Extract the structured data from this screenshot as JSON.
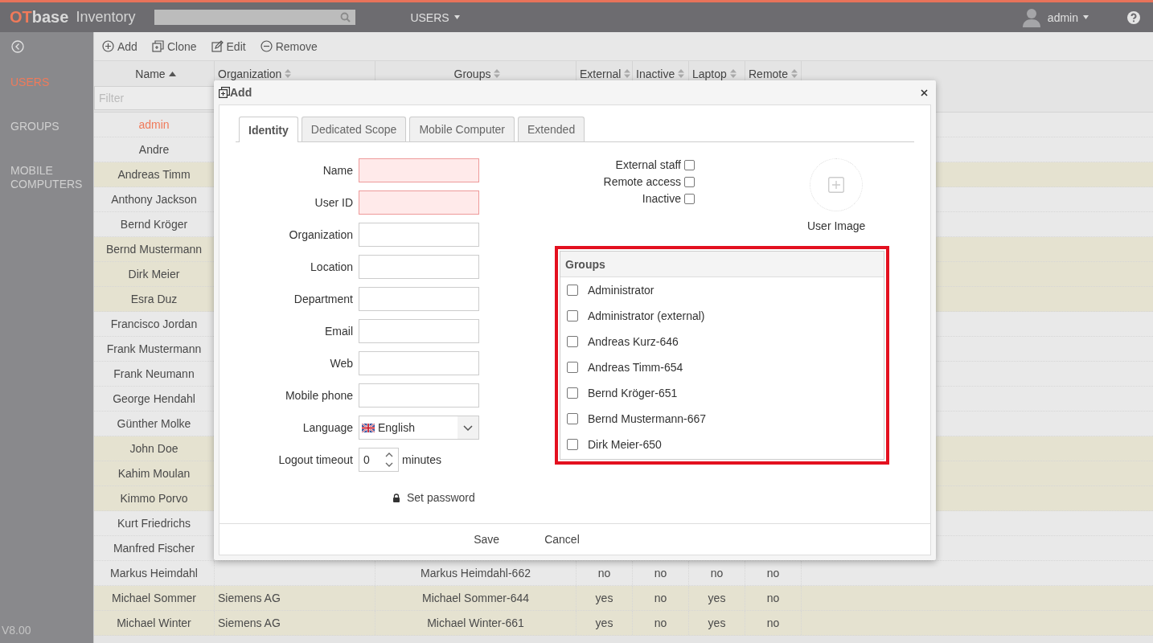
{
  "topbar": {
    "logo_accent": "OT",
    "logo_rest": "base",
    "title": "Inventory",
    "nav": "USERS",
    "user": "admin"
  },
  "sidebar": {
    "items": [
      {
        "label": "USERS",
        "selected": true
      },
      {
        "label": "GROUPS",
        "selected": false
      },
      {
        "label": "MOBILE COMPUTERS",
        "selected": false
      }
    ],
    "version": "V8.00"
  },
  "toolbar": [
    {
      "label": "Add",
      "kind": "add"
    },
    {
      "label": "Clone",
      "kind": "clone"
    },
    {
      "label": "Edit",
      "kind": "edit"
    },
    {
      "label": "Remove",
      "kind": "remove"
    }
  ],
  "table": {
    "columns": [
      {
        "label": "Name",
        "sorted": true
      },
      {
        "label": "Organization",
        "sorted": false
      },
      {
        "label": "Groups",
        "sorted": false
      },
      {
        "label": "External",
        "sorted": false
      },
      {
        "label": "Inactive",
        "sorted": false
      },
      {
        "label": "Laptop",
        "sorted": false
      },
      {
        "label": "Remote",
        "sorted": false
      }
    ],
    "filter_placeholder": "Filter",
    "rows": [
      {
        "cells": [
          "admin"
        ],
        "selected": true,
        "highlighted": false
      },
      {
        "cells": [
          "Andre"
        ],
        "selected": false,
        "highlighted": false
      },
      {
        "cells": [
          "Andreas Timm"
        ],
        "selected": false,
        "highlighted": true
      },
      {
        "cells": [
          "Anthony Jackson"
        ],
        "selected": false,
        "highlighted": false
      },
      {
        "cells": [
          "Bernd Kröger"
        ],
        "selected": false,
        "highlighted": false
      },
      {
        "cells": [
          "Bernd Mustermann"
        ],
        "selected": false,
        "highlighted": true
      },
      {
        "cells": [
          "Dirk Meier"
        ],
        "selected": false,
        "highlighted": true
      },
      {
        "cells": [
          "Esra Duz"
        ],
        "selected": false,
        "highlighted": true
      },
      {
        "cells": [
          "Francisco Jordan"
        ],
        "selected": false,
        "highlighted": false
      },
      {
        "cells": [
          "Frank Mustermann"
        ],
        "selected": false,
        "highlighted": false
      },
      {
        "cells": [
          "Frank Neumann"
        ],
        "selected": false,
        "highlighted": false
      },
      {
        "cells": [
          "George Hendahl"
        ],
        "selected": false,
        "highlighted": false
      },
      {
        "cells": [
          "Günther Molke"
        ],
        "selected": false,
        "highlighted": false
      },
      {
        "cells": [
          "John Doe"
        ],
        "selected": false,
        "highlighted": true
      },
      {
        "cells": [
          "Kahim Moulan"
        ],
        "selected": false,
        "highlighted": true
      },
      {
        "cells": [
          "Kimmo Porvo"
        ],
        "selected": false,
        "highlighted": true
      },
      {
        "cells": [
          "Kurt Friedrichs"
        ],
        "selected": false,
        "highlighted": false
      },
      {
        "cells": [
          "Manfred Fischer"
        ],
        "selected": false,
        "highlighted": false
      },
      {
        "cells": [
          "Markus Heimdahl",
          "",
          "Markus Heimdahl-662",
          "no",
          "no",
          "no",
          "no"
        ],
        "selected": false,
        "highlighted": false
      },
      {
        "cells": [
          "Michael Sommer",
          "Siemens AG",
          "Michael Sommer-644",
          "yes",
          "no",
          "yes",
          "no"
        ],
        "selected": false,
        "highlighted": true
      },
      {
        "cells": [
          "Michael Winter",
          "Siemens AG",
          "Michael Winter-661",
          "yes",
          "no",
          "yes",
          "no"
        ],
        "selected": false,
        "highlighted": true
      }
    ]
  },
  "dialog": {
    "title": "Add",
    "tabs": [
      {
        "label": "Identity",
        "selected": true
      },
      {
        "label": "Dedicated Scope",
        "selected": false
      },
      {
        "label": "Mobile Computer",
        "selected": false
      },
      {
        "label": "Extended",
        "selected": false
      }
    ],
    "fields": [
      {
        "label": "Name",
        "kind": "text",
        "required": true
      },
      {
        "label": "User ID",
        "kind": "text",
        "required": true
      },
      {
        "label": "Organization",
        "kind": "text",
        "required": false
      },
      {
        "label": "Location",
        "kind": "text",
        "required": false
      },
      {
        "label": "Department",
        "kind": "text",
        "required": false
      },
      {
        "label": "Email",
        "kind": "text",
        "required": false
      },
      {
        "label": "Web",
        "kind": "text",
        "required": false
      },
      {
        "label": "Mobile phone",
        "kind": "text",
        "required": false
      },
      {
        "label": "Language",
        "kind": "select",
        "value": "English",
        "required": false
      },
      {
        "label": "Logout timeout",
        "kind": "number",
        "value": "0",
        "unit": "minutes",
        "required": false
      }
    ],
    "set_password": "Set password",
    "flags": [
      {
        "label": "External staff",
        "checked": false
      },
      {
        "label": "Remote access",
        "checked": false
      },
      {
        "label": "Inactive",
        "checked": false
      }
    ],
    "user_image": "User Image",
    "groups": {
      "title": "Groups",
      "highlighted": true,
      "items": [
        {
          "label": "Administrator",
          "checked": false
        },
        {
          "label": "Administrator (external)",
          "checked": false
        },
        {
          "label": "Andreas Kurz-646",
          "checked": false
        },
        {
          "label": "Andreas Timm-654",
          "checked": false
        },
        {
          "label": "Bernd Kröger-651",
          "checked": false
        },
        {
          "label": "Bernd Mustermann-667",
          "checked": false
        },
        {
          "label": "Dirk Meier-650",
          "checked": false
        }
      ]
    },
    "buttons": [
      "Save",
      "Cancel"
    ]
  }
}
